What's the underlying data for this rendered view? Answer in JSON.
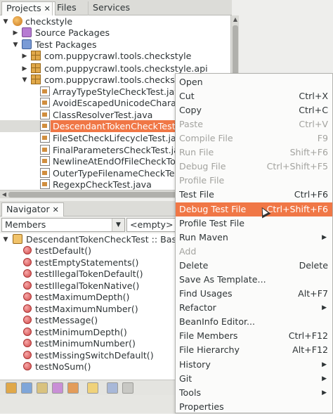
{
  "tabs": {
    "projects": "Projects",
    "projects_close": "✕",
    "files": "Files",
    "services": "Services"
  },
  "project_tree": [
    {
      "label": "checkstyle",
      "icon": "project-icon",
      "expanded": true
    },
    {
      "label": "Source Packages",
      "icon": "source-folder-icon",
      "expanded": false
    },
    {
      "label": "Test Packages",
      "icon": "test-folder-icon",
      "expanded": true
    },
    {
      "label": "com.puppycrawl.tools.checkstyle",
      "icon": "package-icon",
      "expanded": false
    },
    {
      "label": "com.puppycrawl.tools.checkstyle.api",
      "icon": "package-icon",
      "expanded": false
    },
    {
      "label": "com.puppycrawl.tools.checkstyle",
      "icon": "package-icon",
      "expanded": true
    },
    {
      "label": "ArrayTypeStyleCheckTest.java",
      "icon": "java-file-icon"
    },
    {
      "label": "AvoidEscapedUnicodeCharac",
      "icon": "java-file-icon"
    },
    {
      "label": "ClassResolverTest.java",
      "icon": "java-file-icon"
    },
    {
      "label": "DescendantTokenCheckTest",
      "icon": "java-file-icon",
      "selected": true
    },
    {
      "label": "FileSetCheckLifecycleTest.ja",
      "icon": "java-file-icon"
    },
    {
      "label": "FinalParametersCheckTest.ja",
      "icon": "java-file-icon"
    },
    {
      "label": "NewlineAtEndOfFileCheckTo",
      "icon": "java-file-icon"
    },
    {
      "label": "OuterTypeFilenameCheckTe",
      "icon": "java-file-icon"
    },
    {
      "label": "RegexpCheckTest.java",
      "icon": "java-file-icon"
    }
  ],
  "navigator": {
    "tab_label": "Navigator",
    "tab_close": "✕",
    "members_combo": "Members",
    "filter_combo": "<empty>",
    "root": "DescendantTokenCheckTest :: Bas",
    "methods": [
      "testDefault()",
      "testEmptyStatements()",
      "testIllegalTokenDefault()",
      "testIllegalTokenNative()",
      "testMaximumDepth()",
      "testMaximumNumber()",
      "testMessage()",
      "testMinimumDepth()",
      "testMinimumNumber()",
      "testMissingSwitchDefault()",
      "testNoSum()"
    ]
  },
  "context_menu": [
    {
      "label": "Open",
      "shortcut": ""
    },
    {
      "label": "Cut",
      "shortcut": "Ctrl+X"
    },
    {
      "label": "Copy",
      "shortcut": "Ctrl+C"
    },
    {
      "label": "Paste",
      "shortcut": "Ctrl+V",
      "disabled": true
    },
    {
      "label": "Compile File",
      "shortcut": "F9",
      "disabled": true
    },
    {
      "label": "Run File",
      "shortcut": "Shift+F6",
      "disabled": true
    },
    {
      "label": "Debug File",
      "shortcut": "Ctrl+Shift+F5",
      "disabled": true
    },
    {
      "label": "Profile File",
      "shortcut": "",
      "disabled": true
    },
    {
      "label": "Test File",
      "shortcut": "Ctrl+F6"
    },
    {
      "label": "Debug Test File",
      "shortcut": "Ctrl+Shift+F6",
      "highlighted": true
    },
    {
      "label": "Profile Test File",
      "shortcut": ""
    },
    {
      "label": "Run Maven",
      "shortcut": "",
      "submenu": true
    },
    {
      "label": "Add",
      "shortcut": "",
      "disabled": true
    },
    {
      "label": "Delete",
      "shortcut": "Delete"
    },
    {
      "label": "Save As Template...",
      "shortcut": ""
    },
    {
      "label": "Find Usages",
      "shortcut": "Alt+F7"
    },
    {
      "label": "Refactor",
      "shortcut": "",
      "submenu": true
    },
    {
      "label": "BeanInfo Editor...",
      "shortcut": ""
    },
    {
      "label": "File Members",
      "shortcut": "Ctrl+F12"
    },
    {
      "label": "File Hierarchy",
      "shortcut": "Alt+F12"
    },
    {
      "label": "History",
      "shortcut": "",
      "submenu": true
    },
    {
      "label": "Git",
      "shortcut": "",
      "submenu": true
    },
    {
      "label": "Tools",
      "shortcut": "",
      "submenu": true
    },
    {
      "label": "Properties",
      "shortcut": ""
    }
  ],
  "colors": {
    "selection": "#f07746",
    "disabled_text": "#a3a39f"
  }
}
